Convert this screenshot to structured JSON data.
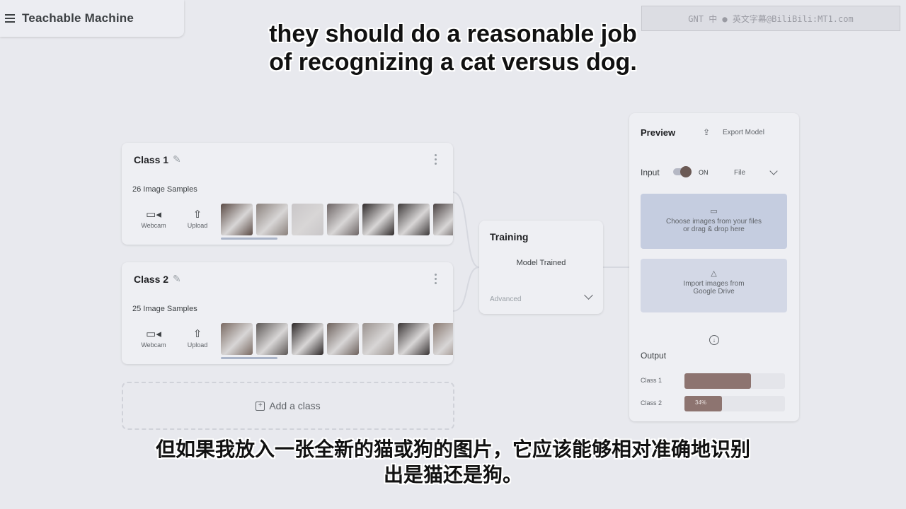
{
  "app": {
    "title": "Teachable Machine"
  },
  "watermark": {
    "text": "GNT 中 ● 英文字幕@BiliBili:MT1.com"
  },
  "subtitles": {
    "english_line1": "they should do a reasonable job",
    "english_line2": "of recognizing a cat versus dog.",
    "chinese_line1": "但如果我放入一张全新的猫或狗的图片，它应该能够相对准确地识别",
    "chinese_line2": "出是猫还是狗。"
  },
  "classes": [
    {
      "title": "Class 1",
      "samples": "26 Image Samples",
      "webcam_label": "Webcam",
      "upload_label": "Upload",
      "thumb_colors": [
        "#5b4b45",
        "#8a817c",
        "#c9c6c8",
        "#6d6565",
        "#2f2a2a",
        "#3e3a3a",
        "#4a4242"
      ]
    },
    {
      "title": "Class 2",
      "samples": "25 Image Samples",
      "webcam_label": "Webcam",
      "upload_label": "Upload",
      "thumb_colors": [
        "#7a6a62",
        "#5d5856",
        "#2c2727",
        "#6e625d",
        "#9a928e",
        "#3a3535",
        "#8a7a72"
      ]
    }
  ],
  "add_class": {
    "label": "Add a class"
  },
  "training": {
    "title": "Training",
    "status": "Model Trained",
    "advanced_label": "Advanced"
  },
  "preview": {
    "title": "Preview",
    "export_label": "Export Model",
    "input_label": "Input",
    "toggle_state": "ON",
    "source_selected": "File",
    "upload_text_line1": "Choose images from your files",
    "upload_text_line2": "or drag & drop here",
    "drive_text_line1": "Import images from",
    "drive_text_line2": "Google Drive",
    "output_label": "Output",
    "outputs": [
      {
        "name": "Class 1",
        "percent_text": "",
        "fraction": 0.66
      },
      {
        "name": "Class 2",
        "percent_text": "34%",
        "fraction": 0.37
      }
    ],
    "bar_color": "#8d7470"
  }
}
